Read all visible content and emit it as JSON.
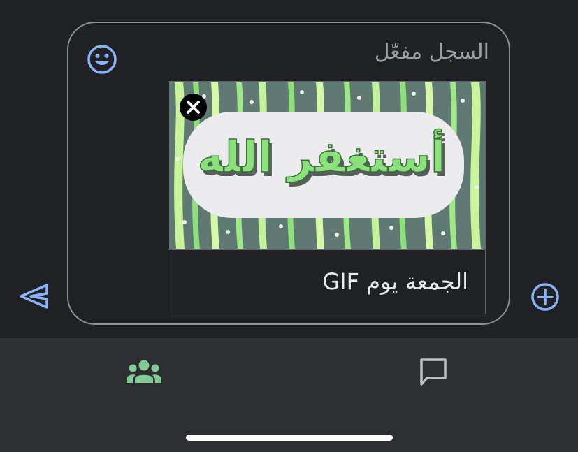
{
  "compose": {
    "history_label": "السجل مفعّل",
    "attachment_caption": "الجمعة يوم GIF"
  },
  "gif": {
    "text": "أستغفر الله"
  },
  "icons": {
    "emoji": "emoji-icon",
    "remove": "close-icon",
    "send": "send-icon",
    "add": "add-icon",
    "people": "people-icon",
    "chat": "chat-icon"
  },
  "colors": {
    "background": "#202124",
    "bottom_bar": "#2d2e31",
    "accent_blue": "#8ab4f8",
    "active_green": "#81c995",
    "muted_text": "#9aa0a6"
  }
}
